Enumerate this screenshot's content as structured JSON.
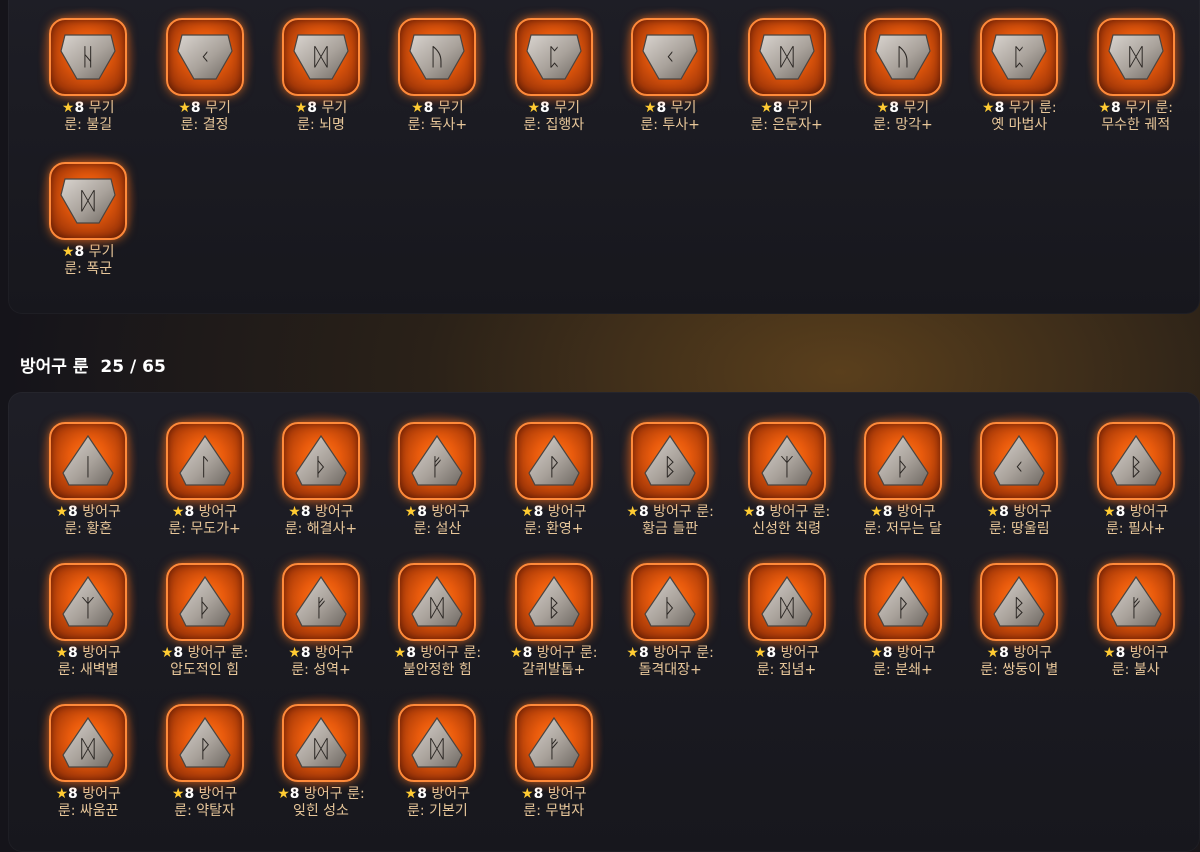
{
  "weapon_runes": [
    {
      "level": "8",
      "label": "무기\n룬: 불길",
      "glyph": "ᚺ"
    },
    {
      "level": "8",
      "label": "무기\n룬: 결정",
      "glyph": "ᚲ"
    },
    {
      "level": "8",
      "label": "무기\n룬: 뇌명",
      "glyph": "ᛞ"
    },
    {
      "level": "8",
      "label": "무기\n룬: 독사+",
      "glyph": "ᚢ"
    },
    {
      "level": "8",
      "label": "무기\n룬: 집행자",
      "glyph": "ᛈ"
    },
    {
      "level": "8",
      "label": "무기\n룬: 투사+",
      "glyph": "ᚲ"
    },
    {
      "level": "8",
      "label": "무기\n룬: 은둔자+",
      "glyph": "ᛞ"
    },
    {
      "level": "8",
      "label": "무기\n룬: 망각+",
      "glyph": "ᚢ"
    },
    {
      "level": "8",
      "label": "무기 룬:\n옛 마법사",
      "glyph": "ᛈ"
    },
    {
      "level": "8",
      "label": "무기 룬:\n무수한 궤적",
      "glyph": "ᛞ"
    },
    {
      "level": "8",
      "label": "무기\n룬: 폭군",
      "glyph": "ᛞ"
    }
  ],
  "armor_section": {
    "title": "방어구 룬",
    "count": "25 / 65"
  },
  "armor_runes": [
    {
      "level": "8",
      "label": "방어구\n룬: 황혼",
      "glyph": "ᛁ"
    },
    {
      "level": "8",
      "label": "방어구\n룬: 무도가+",
      "glyph": "ᛚ"
    },
    {
      "level": "8",
      "label": "방어구\n룬: 해결사+",
      "glyph": "ᚦ"
    },
    {
      "level": "8",
      "label": "방어구\n룬: 설산",
      "glyph": "ᚠ"
    },
    {
      "level": "8",
      "label": "방어구\n룬: 환영+",
      "glyph": "ᚹ"
    },
    {
      "level": "8",
      "label": "방어구 룬:\n황금 들판",
      "glyph": "ᛒ"
    },
    {
      "level": "8",
      "label": "방어구 룬:\n신성한 칙령",
      "glyph": "ᛉ"
    },
    {
      "level": "8",
      "label": "방어구\n룬: 저무는 달",
      "glyph": "ᚦ"
    },
    {
      "level": "8",
      "label": "방어구\n룬: 땅울림",
      "glyph": "ᚲ"
    },
    {
      "level": "8",
      "label": "방어구\n룬: 필사+",
      "glyph": "ᛒ"
    },
    {
      "level": "8",
      "label": "방어구\n룬: 새벽별",
      "glyph": "ᛉ"
    },
    {
      "level": "8",
      "label": "방어구 룬:\n압도적인 힘",
      "glyph": "ᚦ"
    },
    {
      "level": "8",
      "label": "방어구\n룬: 성역+",
      "glyph": "ᚠ"
    },
    {
      "level": "8",
      "label": "방어구 룬:\n불안정한 힘",
      "glyph": "ᛞ"
    },
    {
      "level": "8",
      "label": "방어구 룬:\n갈퀴발톱+",
      "glyph": "ᛒ"
    },
    {
      "level": "8",
      "label": "방어구 룬:\n돌격대장+",
      "glyph": "ᚦ"
    },
    {
      "level": "8",
      "label": "방어구\n룬: 집념+",
      "glyph": "ᛞ"
    },
    {
      "level": "8",
      "label": "방어구\n룬: 분쇄+",
      "glyph": "ᚹ"
    },
    {
      "level": "8",
      "label": "방어구\n룬: 쌍둥이 별",
      "glyph": "ᛒ"
    },
    {
      "level": "8",
      "label": "방어구\n룬: 불사",
      "glyph": "ᚠ"
    },
    {
      "level": "8",
      "label": "방어구\n룬: 싸움꾼",
      "glyph": "ᛞ"
    },
    {
      "level": "8",
      "label": "방어구\n룬: 약탈자",
      "glyph": "ᚹ"
    },
    {
      "level": "8",
      "label": "방어구 룬:\n잊힌 성소",
      "glyph": "ᛞ"
    },
    {
      "level": "8",
      "label": "방어구\n룬: 기본기",
      "glyph": "ᛞ"
    },
    {
      "level": "8",
      "label": "방어구\n룬: 무법자",
      "glyph": "ᚠ"
    }
  ],
  "colors": {
    "accent_orange": "#ff8a3a",
    "star_yellow": "#ffcc33",
    "label_text": "#e8c79a"
  }
}
